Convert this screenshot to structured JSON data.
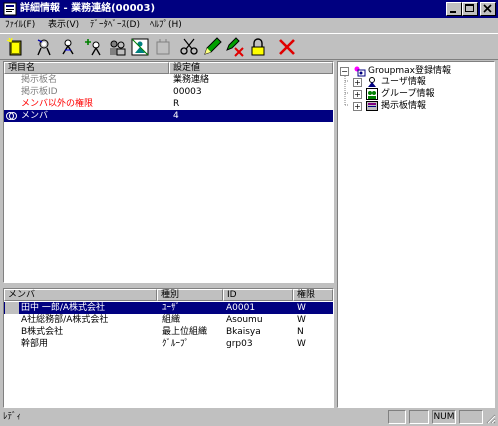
{
  "window": {
    "title": "詳細情報 - 業務連絡(00003)"
  },
  "menu": [
    {
      "label": "ﾌｧｲﾙ(F)"
    },
    {
      "label": "表示(V)"
    },
    {
      "label": "ﾃﾞｰﾀﾍﾞｰｽ(D)"
    },
    {
      "label": "ﾍﾙﾌﾟ(H)"
    }
  ],
  "properties": {
    "columns": [
      "項目名",
      "設定値"
    ],
    "rows": [
      {
        "name": "掲示板名",
        "value": "業務連絡"
      },
      {
        "name": "掲示板ID",
        "value": "00003"
      },
      {
        "name": "メンバ以外の権限",
        "value": "R"
      },
      {
        "name": "メンバ",
        "value": "4"
      }
    ]
  },
  "members": {
    "columns": [
      "メンバ",
      "種別",
      "ID",
      "権限"
    ],
    "rows": [
      {
        "name": "田中 一郎/A株式会社",
        "type": "ﾕｰｻﾞ",
        "id": "A0001",
        "perm": "W"
      },
      {
        "name": "A社総務部/A株式会社",
        "type": "組織",
        "id": "Asoumu",
        "perm": "W"
      },
      {
        "name": "B株式会社",
        "type": "最上位組織",
        "id": "Bkaisya",
        "perm": "N"
      },
      {
        "name": "幹部用",
        "type": "ｸﾞﾙｰﾌﾟ",
        "id": "grp03",
        "perm": "W"
      }
    ]
  },
  "tree": {
    "root": "Groupmax登録情報",
    "children": [
      {
        "label": "ユーザ情報"
      },
      {
        "label": "グループ情報"
      },
      {
        "label": "掲示板情報"
      }
    ]
  },
  "status": {
    "text": "ﾚﾃﾞｨ",
    "num": "NUM"
  },
  "colors": {
    "title_bar": "#000080",
    "selection": "#000080",
    "warning_text": "#ff0000",
    "face": "#c0c0c0"
  }
}
